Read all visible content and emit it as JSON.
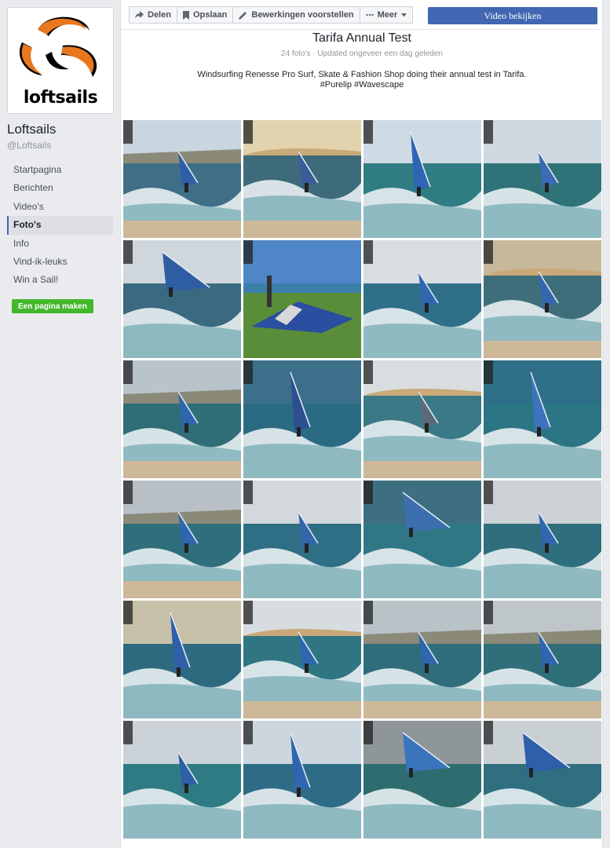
{
  "page": {
    "name": "Loftsails",
    "handle": "@Loftsails",
    "logo_text": "loftsails"
  },
  "nav": {
    "items": [
      {
        "label": "Startpagina"
      },
      {
        "label": "Berichten"
      },
      {
        "label": "Video's"
      },
      {
        "label": "Foto's"
      },
      {
        "label": "Info"
      },
      {
        "label": "Vind-ik-leuks"
      },
      {
        "label": "Win a Sail!"
      }
    ],
    "active_index": 3
  },
  "create_page_label": "Een pagina maken",
  "toolbar": {
    "share_label": "Delen",
    "save_label": "Opslaan",
    "suggest_label": "Bewerkingen voorstellen",
    "more_label": "Meer",
    "video_label": "Video bekijken"
  },
  "album": {
    "title": "Tarifa Annual Test",
    "meta": "24 foto's · Updated ongeveer een dag geleden",
    "description_line1": "Windsurfing Renesse Pro Surf, Skate & Fashion Shop doing their annual test in Tarifa.",
    "description_line2": "#Purelip #Wavescape"
  },
  "colors": {
    "brand_orange": "#e8771e",
    "fb_blue": "#4267b2",
    "green": "#42b72a"
  },
  "photos": [
    {
      "sky": "#c9d6df",
      "sea": "#3e6f86",
      "sail": "#2f5fa8",
      "variant": 1
    },
    {
      "sky": "#e2d2ae",
      "sea": "#3d6b7c",
      "sail": "#3a5c9a",
      "variant": 2
    },
    {
      "sky": "#cfdbe4",
      "sea": "#2f7d82",
      "sail": "#2e66b3",
      "variant": 3
    },
    {
      "sky": "#ced8e0",
      "sea": "#2f7378",
      "sail": "#3b6bb5",
      "variant": 0
    },
    {
      "sky": "#cfd6dc",
      "sea": "#3a6a80",
      "sail": "#2e5da3",
      "variant": 4
    },
    {
      "sky": "#4f86c7",
      "sea": "#5a8d3a",
      "sail": "#2a4ea0",
      "variant": 5
    },
    {
      "sky": "#d8dde2",
      "sea": "#2f6f88",
      "sail": "#3066b0",
      "variant": 0
    },
    {
      "sky": "#c8b89a",
      "sea": "#3f6e7b",
      "sail": "#3466ad",
      "variant": 2
    },
    {
      "sky": "#b9c3ca",
      "sea": "#2f6d77",
      "sail": "#2f66b0",
      "variant": 1
    },
    {
      "sky": "#3b6f8a",
      "sea": "#2a6b83",
      "sail": "#2e4f8f",
      "variant": 3
    },
    {
      "sky": "#d9dde0",
      "sea": "#3a7a86",
      "sail": "#5a6a7a",
      "variant": 2
    },
    {
      "sky": "#2f6f87",
      "sea": "#2b7584",
      "sail": "#3d73bd",
      "variant": 3
    },
    {
      "sky": "#b8c0c6",
      "sea": "#2f6f7c",
      "sail": "#2f66b0",
      "variant": 1
    },
    {
      "sky": "#d3d8dc",
      "sea": "#2f6f86",
      "sail": "#3366aa",
      "variant": 0
    },
    {
      "sky": "#3d6f80",
      "sea": "#2f7784",
      "sail": "#3d6fb0",
      "variant": 4
    },
    {
      "sky": "#cbd1d5",
      "sea": "#2e6e7d",
      "sail": "#3266b1",
      "variant": 0
    },
    {
      "sky": "#c7c0a8",
      "sea": "#2d6a7f",
      "sail": "#2f5fa8",
      "variant": 3
    },
    {
      "sky": "#d7dce0",
      "sea": "#2f7682",
      "sail": "#2f66b0",
      "variant": 2
    },
    {
      "sky": "#b9c2c7",
      "sea": "#2f6d7b",
      "sail": "#2f66b0",
      "variant": 1
    },
    {
      "sky": "#bfc6ca",
      "sea": "#2f6f7a",
      "sail": "#2f66b0",
      "variant": 1
    },
    {
      "sky": "#cbd2d7",
      "sea": "#2f7b84",
      "sail": "#2f5fa8",
      "variant": 0
    },
    {
      "sky": "#cbd6df",
      "sea": "#2d6c84",
      "sail": "#2f66b0",
      "variant": 3
    },
    {
      "sky": "#8e969a",
      "sea": "#2d6d6f",
      "sail": "#3a74bd",
      "variant": 4
    },
    {
      "sky": "#c9d0d4",
      "sea": "#2f6f80",
      "sail": "#2f5fa8",
      "variant": 4
    }
  ]
}
